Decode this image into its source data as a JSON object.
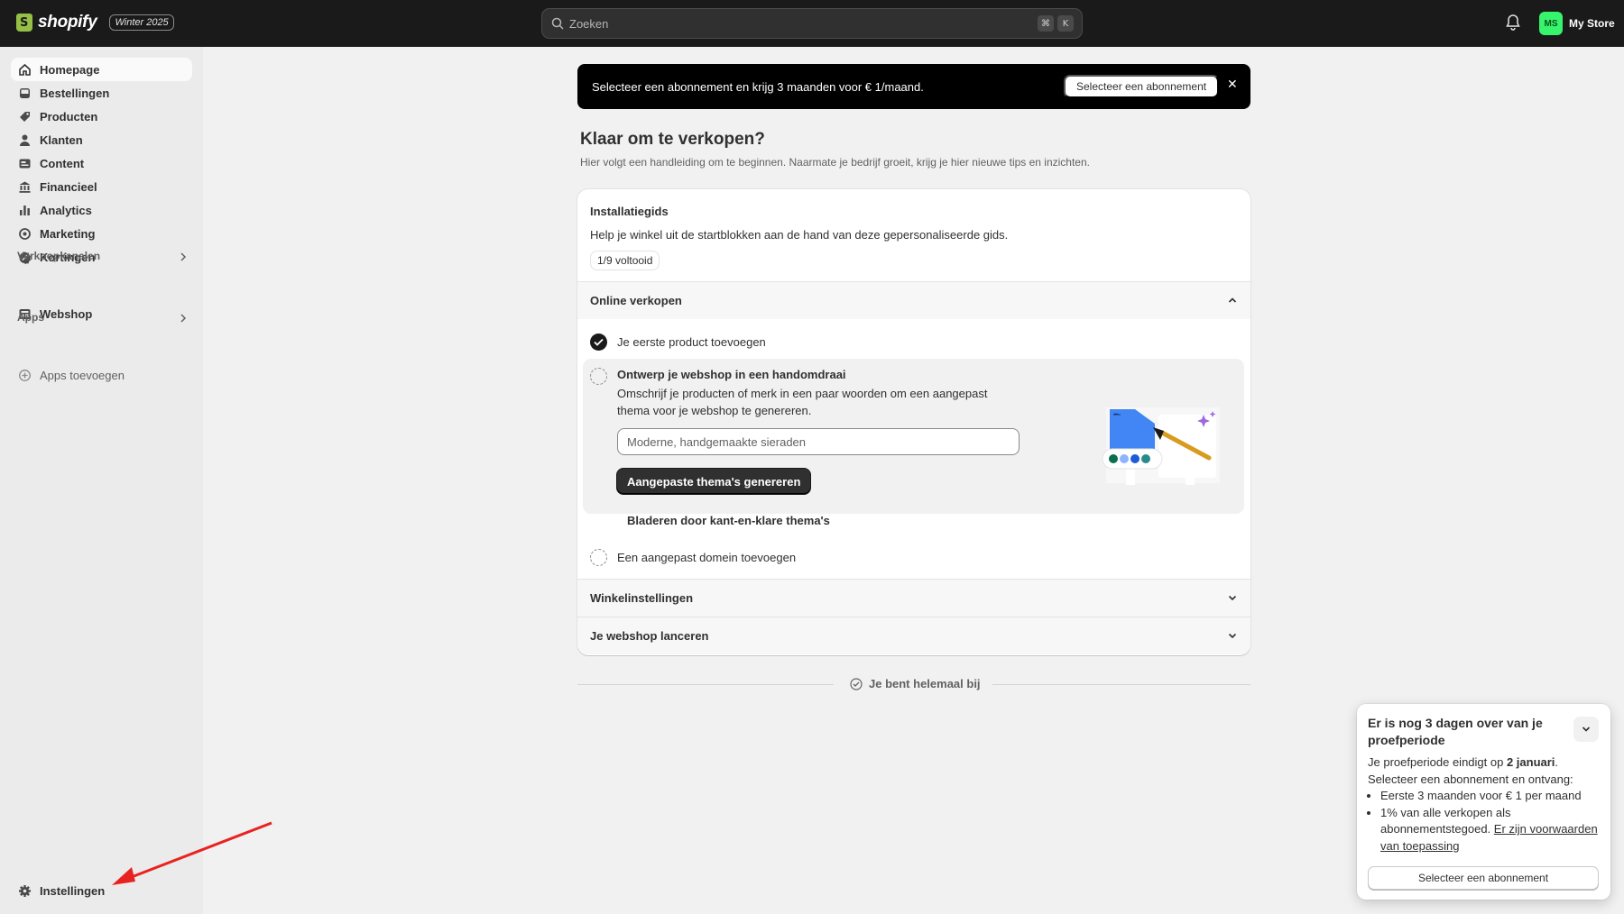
{
  "topbar": {
    "brand": "shopify",
    "edition": "Winter 2025",
    "search_placeholder": "Zoeken",
    "search_shortcut": [
      "⌘",
      "K"
    ],
    "store_initials": "MS",
    "store_name": "My Store",
    "avatar_color": "#36f56c"
  },
  "sidebar": {
    "items": [
      {
        "label": "Homepage",
        "icon": "home-icon"
      },
      {
        "label": "Bestellingen",
        "icon": "inbox-icon"
      },
      {
        "label": "Producten",
        "icon": "tag-icon"
      },
      {
        "label": "Klanten",
        "icon": "person-icon"
      },
      {
        "label": "Content",
        "icon": "content-icon"
      },
      {
        "label": "Financieel",
        "icon": "bank-icon"
      },
      {
        "label": "Analytics",
        "icon": "bar-chart-icon"
      },
      {
        "label": "Marketing",
        "icon": "target-icon"
      },
      {
        "label": "Kortingen",
        "icon": "discount-icon"
      }
    ],
    "sales_channels_label": "Verkoopkanalen",
    "webshop_label": "Webshop",
    "apps_label": "Apps",
    "add_apps_label": "Apps toevoegen",
    "settings_label": "Instellingen"
  },
  "banner": {
    "text": "Selecteer een abonnement en krijg 3 maanden voor € 1/maand.",
    "button": "Selecteer een abonnement",
    "close": "✕"
  },
  "main": {
    "title": "Klaar om te verkopen?",
    "subtitle": "Hier volgt een handleiding om te beginnen. Naarmate je bedrijf groeit, krijg je hier nieuwe tips en inzichten."
  },
  "guide": {
    "title": "Installatiegids",
    "description": "Help je winkel uit de startblokken aan de hand van deze gepersonaliseerde gids.",
    "progress": "1/9 voltooid",
    "sections": [
      {
        "title": "Online verkopen",
        "expanded": true
      },
      {
        "title": "Winkelinstellingen",
        "expanded": false
      },
      {
        "title": "Je webshop lanceren",
        "expanded": false
      }
    ],
    "tasks": {
      "first_product": "Je eerste product toevoegen",
      "design_title": "Ontwerp je webshop in een handomdraai",
      "design_desc": "Omschrijf je producten of merk in een paar woorden om een aangepast thema voor je webshop te genereren.",
      "design_placeholder": "Moderne, handgemaakte sieraden",
      "design_button": "Aangepaste thema's genereren",
      "design_link": "Bladeren door kant-en-klare thema's",
      "domain": "Een aangepast domein toevoegen"
    },
    "footer": "Je bent helemaal bij"
  },
  "trial_toast": {
    "title": "Er is nog 3 dagen over van je proefperiode",
    "line1_prefix": "Je proefperiode eindigt op ",
    "line1_date": "2 januari",
    "line1_suffix": ".",
    "line2": "Selecteer een abonnement en ontvang:",
    "bullet1": "Eerste 3 maanden voor € 1 per maand",
    "bullet2_text": "1% van alle verkopen als abonnementstegoed. ",
    "bullet2_link": "Er zijn voorwaarden van toepassing",
    "button": "Selecteer een abonnement"
  },
  "annotation_color": "#e8231f"
}
